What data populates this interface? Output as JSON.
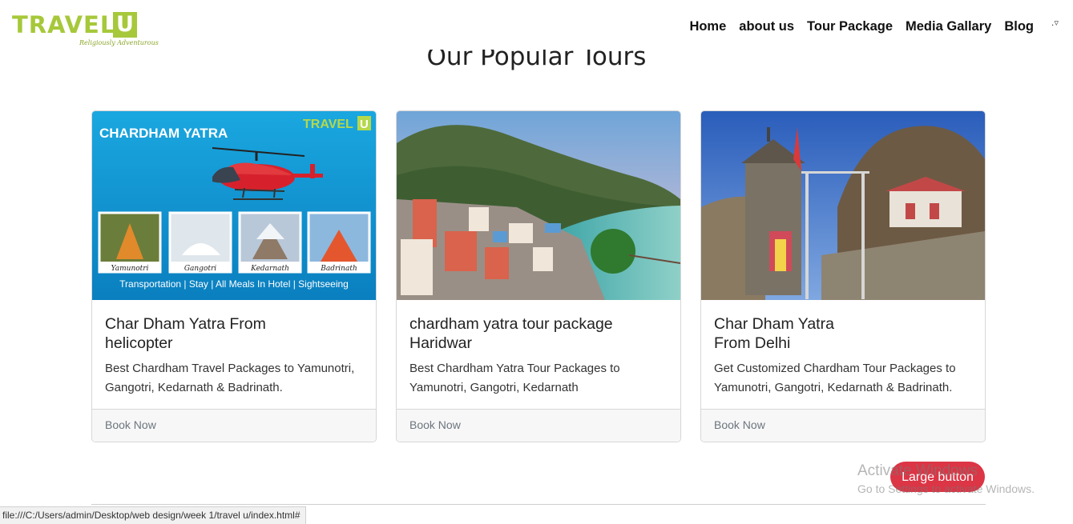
{
  "brand": {
    "name": "TRAVEL",
    "mark": "U",
    "tagline": "Religiously Adventurous",
    "color": "#a6c83a"
  },
  "nav": {
    "links": [
      "Home",
      "about us",
      "Tour Package",
      "Media Gallary",
      "Blog"
    ],
    "toggle_icon": "caret-down-icon"
  },
  "section": {
    "title": "Our Popular Tours"
  },
  "cards": [
    {
      "image": "chardham-yatra-helicopter-banner",
      "banner_title": "CHARDHAM YATRA",
      "banner_places": [
        "Yamunotri",
        "Gangotri",
        "Kedarnath",
        "Badrinath"
      ],
      "banner_footer": "Transportation | Stay | All Meals In Hotel | Sightseeing",
      "title": "Char Dham Yatra From\nhelicopter",
      "text": "Best Chardham Travel Packages to Yamunotri, Gangotri, Kedarnath & Badrinath.",
      "footer": "Book Now"
    },
    {
      "image": "rishikesh-river-town-photo",
      "title": "chardham yatra tour package\nHaridwar",
      "text": "Best Chardham Yatra Tour Packages to Yamunotri, Gangotri, Kedarnath",
      "footer": "Book Now"
    },
    {
      "image": "mountain-stone-temple-photo",
      "title": "Char Dham Yatra\nFrom Delhi",
      "text": "Get Customized Chardham Tour Packages to Yamunotri, Gangotri, Kedarnath & Badrinath.",
      "footer": "Book Now"
    }
  ],
  "large_button": {
    "label": "Large button",
    "color": "#dc3545"
  },
  "watermark": {
    "title": "Activate Windows",
    "subtitle": "Go to Settings to activate Windows."
  },
  "statusbar": {
    "url": "file:///C:/Users/admin/Desktop/web design/week 1/travel u/index.html#"
  }
}
